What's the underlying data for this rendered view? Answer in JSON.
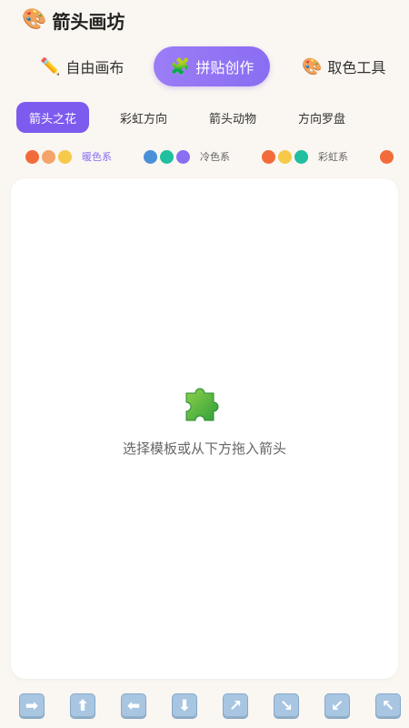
{
  "app": {
    "title": "箭头画坊",
    "icon": "palette-icon"
  },
  "modes": [
    {
      "label": "自由画布",
      "icon": "pencil-icon",
      "active": false
    },
    {
      "label": "拼贴创作",
      "icon": "puzzle-icon",
      "active": true
    },
    {
      "label": "取色工具",
      "icon": "palette-icon",
      "active": false
    }
  ],
  "categories": [
    {
      "label": "箭头之花",
      "active": true
    },
    {
      "label": "彩虹方向",
      "active": false
    },
    {
      "label": "箭头动物",
      "active": false
    },
    {
      "label": "方向罗盘",
      "active": false
    }
  ],
  "palettes": [
    {
      "name": "暖色系",
      "name_color": "#8a6df2",
      "colors": [
        "#f26b3a",
        "#f4a36a",
        "#f7c948"
      ]
    },
    {
      "name": "冷色系",
      "name_color": "#666666",
      "colors": [
        "#4a90d9",
        "#1fbfa0",
        "#8a6df2"
      ]
    },
    {
      "name": "彩虹系",
      "name_color": "#666666",
      "colors": [
        "#f26b3a",
        "#f7c948",
        "#1fbfa0"
      ]
    }
  ],
  "canvas": {
    "placeholder_icon": "puzzle-icon",
    "hint": "选择模板或从下方拖入箭头"
  },
  "arrow_palette": [
    {
      "icon": "arrow-right-icon",
      "glyph": "➡"
    },
    {
      "icon": "arrow-up-icon",
      "glyph": "⬆"
    },
    {
      "icon": "arrow-left-icon",
      "glyph": "⬅"
    },
    {
      "icon": "arrow-down-icon",
      "glyph": "⬇"
    },
    {
      "icon": "arrow-up-right-icon",
      "glyph": "↗"
    },
    {
      "icon": "arrow-down-right-icon",
      "glyph": "↘"
    },
    {
      "icon": "arrow-down-left-icon",
      "glyph": "↙"
    },
    {
      "icon": "arrow-up-left-icon",
      "glyph": "↖"
    }
  ]
}
